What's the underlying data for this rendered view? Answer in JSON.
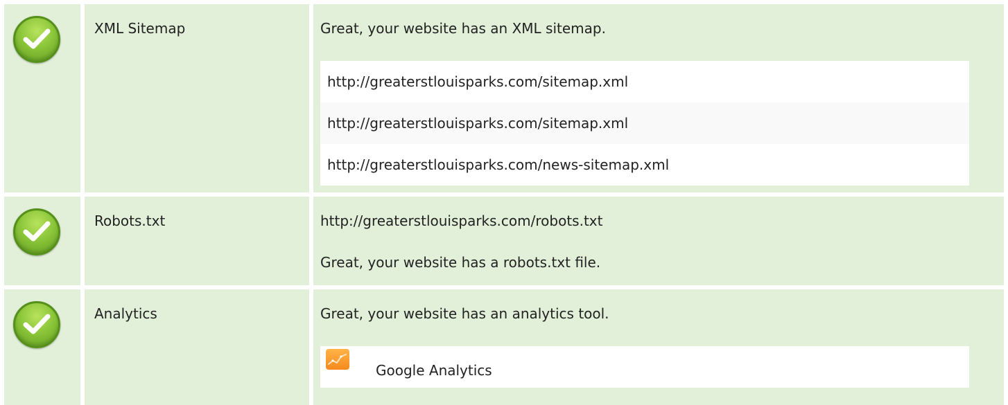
{
  "rows": [
    {
      "status": "passed",
      "label": "XML Sitemap",
      "message": "Great, your website has an XML sitemap.",
      "sitemaps": [
        "http://greaterstlouisparks.com/sitemap.xml",
        "http://greaterstlouisparks.com/sitemap.xml",
        "http://greaterstlouisparks.com/news-sitemap.xml"
      ]
    },
    {
      "status": "passed",
      "label": "Robots.txt",
      "url": "http://greaterstlouisparks.com/robots.txt",
      "message": "Great, your website has a robots.txt file."
    },
    {
      "status": "passed",
      "label": "Analytics",
      "message": "Great, your website has an analytics tool.",
      "tools": [
        {
          "name": "Google Analytics",
          "icon": "google-analytics-icon"
        }
      ]
    }
  ],
  "colors": {
    "row_background": "#e2f0d9",
    "check_green": "#8cc63a",
    "analytics_orange": "#f68a1e"
  }
}
